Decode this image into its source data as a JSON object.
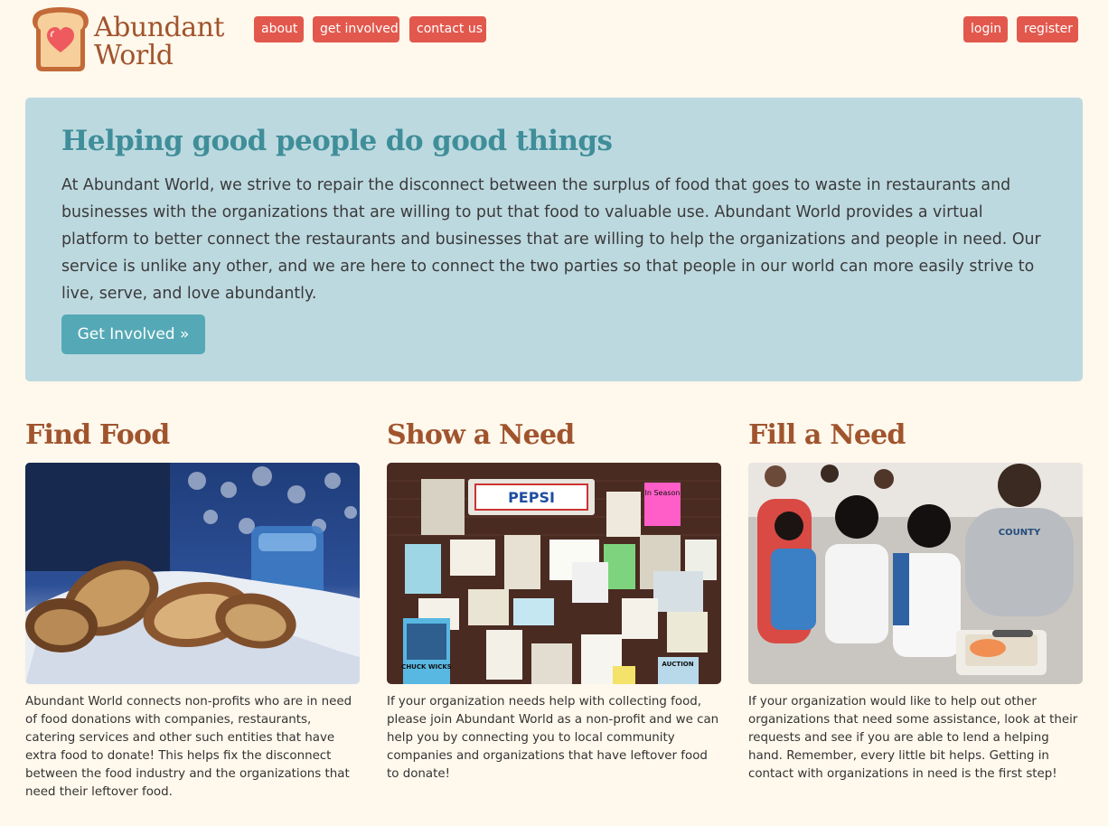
{
  "brand": {
    "line1": "Abundant",
    "line2": "World"
  },
  "nav": {
    "about": "about",
    "get_involved": "get involved",
    "contact_us": "contact us",
    "login": "login",
    "register": "register"
  },
  "hero": {
    "title": "Helping good people do good things",
    "text": "At Abundant World, we strive to repair the disconnect between the surplus of food that goes to waste in restaurants and businesses with the organizations that are willing to put that food to valuable use. Abundant World provides a virtual platform to better connect the restaurants and businesses that are willing to help the organizations and people in need. Our service is unlike any other, and we are here to connect the two parties so that people in our world can more easily strive to live, serve, and love abundantly.",
    "button": "Get Involved »"
  },
  "columns": [
    {
      "title": "Find Food",
      "text": "Abundant World connects non-profits who are in need of food donations with companies, restaurants, catering services and other such entities that have extra food to donate! This helps fix the disconnect between the food industry and the organizations that need their leftover food."
    },
    {
      "title": "Show a Need",
      "text": "If your organization needs help with collecting food, please join Abundant World as a non-profit and we can help you by connecting you to local community companies and organizations that have leftover food to donate!"
    },
    {
      "title": "Fill a Need",
      "text": "If your organization would like to help out other organizations that need some assistance, look at their requests and see if you are able to lend a helping hand. Remember, every little bit helps. Getting in contact with organizations in need is the first step!"
    }
  ],
  "photo_text": {
    "pepsi": "PEPSI",
    "chuck": "CHUCK WICKS",
    "auction": "AUCTION",
    "season": "In Season",
    "shirt": "COUNTY"
  },
  "colors": {
    "background": "#fff8ec",
    "nav_button": "#e2584d",
    "hero_bg": "#bdd9e0",
    "hero_title": "#3f8e99",
    "hero_button": "#55a9b6",
    "heading_brown": "#a0542d"
  },
  "icons": {
    "logo": "bread-heart-icon"
  }
}
